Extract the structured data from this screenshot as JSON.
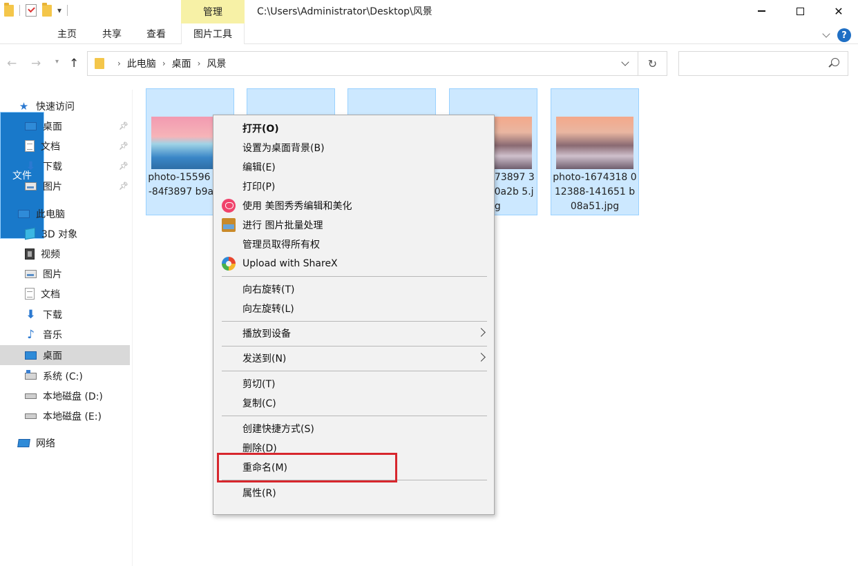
{
  "titlebar": {
    "manage_tab": "管理",
    "path": "C:\\Users\\Administrator\\Desktop\\风景"
  },
  "ribbon": {
    "file": "文件",
    "home": "主页",
    "share": "共享",
    "view": "查看",
    "picture_tools": "图片工具"
  },
  "address": {
    "crumbs": [
      "此电脑",
      "桌面",
      "风景"
    ]
  },
  "sidebar": {
    "items": [
      {
        "label": "快速访问",
        "icon": "star-icon"
      },
      {
        "label": "桌面",
        "icon": "desktop-icon",
        "pinned": true
      },
      {
        "label": "文档",
        "icon": "documents-icon",
        "pinned": true
      },
      {
        "label": "下载",
        "icon": "download-icon",
        "pinned": true
      },
      {
        "label": "图片",
        "icon": "pictures-icon",
        "pinned": true
      },
      {
        "label": "此电脑",
        "icon": "this-pc-icon"
      },
      {
        "label": "3D 对象",
        "icon": "3d-objects-icon"
      },
      {
        "label": "视频",
        "icon": "videos-icon"
      },
      {
        "label": "图片",
        "icon": "pictures-icon"
      },
      {
        "label": "文档",
        "icon": "documents-icon"
      },
      {
        "label": "下载",
        "icon": "download-icon"
      },
      {
        "label": "音乐",
        "icon": "music-icon"
      },
      {
        "label": "桌面",
        "icon": "desktop-icon",
        "selected": true
      },
      {
        "label": "系统 (C:)",
        "icon": "system-drive-icon"
      },
      {
        "label": "本地磁盘 (D:)",
        "icon": "drive-icon"
      },
      {
        "label": "本地磁盘 (E:)",
        "icon": "drive-icon"
      },
      {
        "label": "网络",
        "icon": "network-icon"
      }
    ]
  },
  "files": [
    {
      "name": "photo-15596 126-84f3897 b9a.jpg",
      "thumb": "desert-sunset"
    },
    {
      "name": "",
      "thumb": ""
    },
    {
      "name": "",
      "thumb": ""
    },
    {
      "name": "673897 3a0a2b 5.jpg",
      "thumb": "mountains"
    },
    {
      "name": "photo-1674318 012388-141651 b08a51.jpg",
      "thumb": "mountains"
    }
  ],
  "context_menu": {
    "items": [
      {
        "label": "打开(O)",
        "bold": true
      },
      {
        "label": "设置为桌面背景(B)"
      },
      {
        "label": "编辑(E)"
      },
      {
        "label": "打印(P)"
      },
      {
        "label": "使用 美图秀秀编辑和美化",
        "icon": "meitu-icon"
      },
      {
        "label": "进行 图片批量处理",
        "icon": "batch-process-icon"
      },
      {
        "label": "管理员取得所有权"
      },
      {
        "label": "Upload with ShareX",
        "icon": "sharex-icon"
      },
      {
        "label": "向右旋转(T)"
      },
      {
        "label": "向左旋转(L)"
      },
      {
        "label": "播放到设备",
        "submenu": true
      },
      {
        "label": "发送到(N)",
        "submenu": true
      },
      {
        "label": "剪切(T)"
      },
      {
        "label": "复制(C)"
      },
      {
        "label": "创建快捷方式(S)"
      },
      {
        "label": "删除(D)"
      },
      {
        "label": "重命名(M)",
        "highlighted": true
      },
      {
        "label": "属性(R)"
      }
    ]
  },
  "colors": {
    "accent": "#1979ca",
    "manage_tab": "#f7f1a6",
    "selection": "#cce8ff",
    "highlight_box": "#d7262d"
  }
}
